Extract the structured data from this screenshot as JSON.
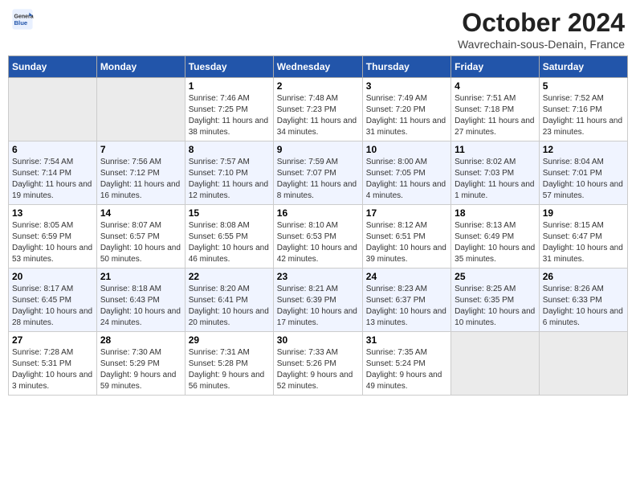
{
  "header": {
    "logo_general": "General",
    "logo_blue": "Blue",
    "title": "October 2024",
    "subtitle": "Wavrechain-sous-Denain, France"
  },
  "weekdays": [
    "Sunday",
    "Monday",
    "Tuesday",
    "Wednesday",
    "Thursday",
    "Friday",
    "Saturday"
  ],
  "weeks": [
    [
      {
        "empty": true
      },
      {
        "empty": true
      },
      {
        "day": 1,
        "sunrise": "7:46 AM",
        "sunset": "7:25 PM",
        "daylight": "11 hours and 38 minutes."
      },
      {
        "day": 2,
        "sunrise": "7:48 AM",
        "sunset": "7:23 PM",
        "daylight": "11 hours and 34 minutes."
      },
      {
        "day": 3,
        "sunrise": "7:49 AM",
        "sunset": "7:20 PM",
        "daylight": "11 hours and 31 minutes."
      },
      {
        "day": 4,
        "sunrise": "7:51 AM",
        "sunset": "7:18 PM",
        "daylight": "11 hours and 27 minutes."
      },
      {
        "day": 5,
        "sunrise": "7:52 AM",
        "sunset": "7:16 PM",
        "daylight": "11 hours and 23 minutes."
      }
    ],
    [
      {
        "day": 6,
        "sunrise": "7:54 AM",
        "sunset": "7:14 PM",
        "daylight": "11 hours and 19 minutes."
      },
      {
        "day": 7,
        "sunrise": "7:56 AM",
        "sunset": "7:12 PM",
        "daylight": "11 hours and 16 minutes."
      },
      {
        "day": 8,
        "sunrise": "7:57 AM",
        "sunset": "7:10 PM",
        "daylight": "11 hours and 12 minutes."
      },
      {
        "day": 9,
        "sunrise": "7:59 AM",
        "sunset": "7:07 PM",
        "daylight": "11 hours and 8 minutes."
      },
      {
        "day": 10,
        "sunrise": "8:00 AM",
        "sunset": "7:05 PM",
        "daylight": "11 hours and 4 minutes."
      },
      {
        "day": 11,
        "sunrise": "8:02 AM",
        "sunset": "7:03 PM",
        "daylight": "11 hours and 1 minute."
      },
      {
        "day": 12,
        "sunrise": "8:04 AM",
        "sunset": "7:01 PM",
        "daylight": "10 hours and 57 minutes."
      }
    ],
    [
      {
        "day": 13,
        "sunrise": "8:05 AM",
        "sunset": "6:59 PM",
        "daylight": "10 hours and 53 minutes."
      },
      {
        "day": 14,
        "sunrise": "8:07 AM",
        "sunset": "6:57 PM",
        "daylight": "10 hours and 50 minutes."
      },
      {
        "day": 15,
        "sunrise": "8:08 AM",
        "sunset": "6:55 PM",
        "daylight": "10 hours and 46 minutes."
      },
      {
        "day": 16,
        "sunrise": "8:10 AM",
        "sunset": "6:53 PM",
        "daylight": "10 hours and 42 minutes."
      },
      {
        "day": 17,
        "sunrise": "8:12 AM",
        "sunset": "6:51 PM",
        "daylight": "10 hours and 39 minutes."
      },
      {
        "day": 18,
        "sunrise": "8:13 AM",
        "sunset": "6:49 PM",
        "daylight": "10 hours and 35 minutes."
      },
      {
        "day": 19,
        "sunrise": "8:15 AM",
        "sunset": "6:47 PM",
        "daylight": "10 hours and 31 minutes."
      }
    ],
    [
      {
        "day": 20,
        "sunrise": "8:17 AM",
        "sunset": "6:45 PM",
        "daylight": "10 hours and 28 minutes."
      },
      {
        "day": 21,
        "sunrise": "8:18 AM",
        "sunset": "6:43 PM",
        "daylight": "10 hours and 24 minutes."
      },
      {
        "day": 22,
        "sunrise": "8:20 AM",
        "sunset": "6:41 PM",
        "daylight": "10 hours and 20 minutes."
      },
      {
        "day": 23,
        "sunrise": "8:21 AM",
        "sunset": "6:39 PM",
        "daylight": "10 hours and 17 minutes."
      },
      {
        "day": 24,
        "sunrise": "8:23 AM",
        "sunset": "6:37 PM",
        "daylight": "10 hours and 13 minutes."
      },
      {
        "day": 25,
        "sunrise": "8:25 AM",
        "sunset": "6:35 PM",
        "daylight": "10 hours and 10 minutes."
      },
      {
        "day": 26,
        "sunrise": "8:26 AM",
        "sunset": "6:33 PM",
        "daylight": "10 hours and 6 minutes."
      }
    ],
    [
      {
        "day": 27,
        "sunrise": "7:28 AM",
        "sunset": "5:31 PM",
        "daylight": "10 hours and 3 minutes."
      },
      {
        "day": 28,
        "sunrise": "7:30 AM",
        "sunset": "5:29 PM",
        "daylight": "9 hours and 59 minutes."
      },
      {
        "day": 29,
        "sunrise": "7:31 AM",
        "sunset": "5:28 PM",
        "daylight": "9 hours and 56 minutes."
      },
      {
        "day": 30,
        "sunrise": "7:33 AM",
        "sunset": "5:26 PM",
        "daylight": "9 hours and 52 minutes."
      },
      {
        "day": 31,
        "sunrise": "7:35 AM",
        "sunset": "5:24 PM",
        "daylight": "9 hours and 49 minutes."
      },
      {
        "empty": true
      },
      {
        "empty": true
      }
    ]
  ],
  "labels": {
    "sunrise": "Sunrise:",
    "sunset": "Sunset:",
    "daylight": "Daylight:"
  }
}
